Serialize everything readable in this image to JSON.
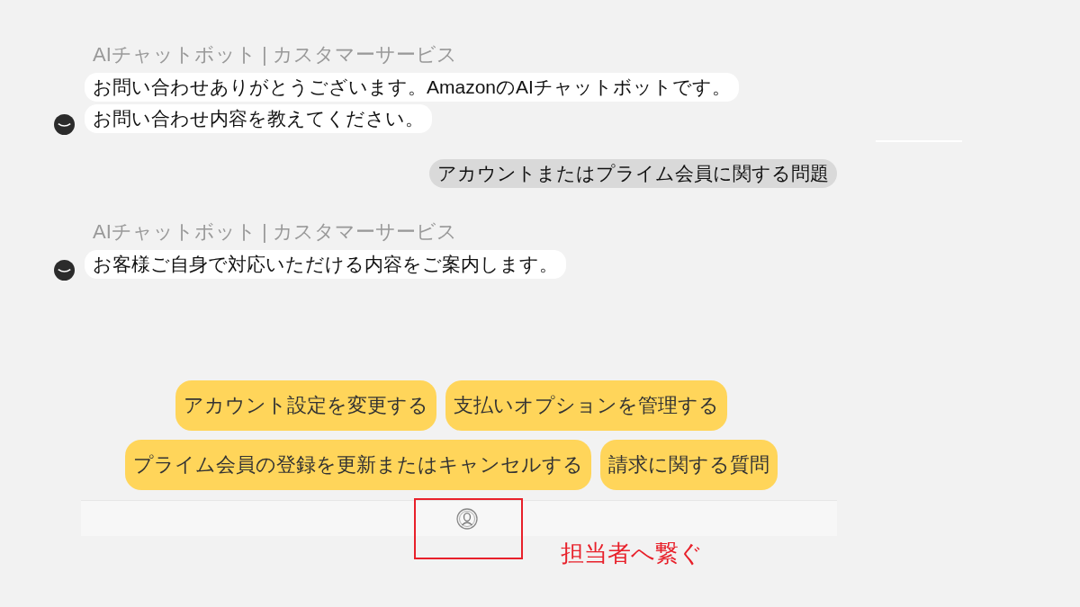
{
  "messages": [
    {
      "kind": "bot",
      "sender": "AIチャットボット | カスタマーサービス",
      "lines": [
        "お問い合わせありがとうございます。AmazonのAIチャットボットです。",
        "お問い合わせ内容を教えてください。"
      ]
    },
    {
      "kind": "user",
      "lines": [
        "アカウントまたはプライム会員に関する問題"
      ]
    },
    {
      "kind": "bot",
      "sender": "AIチャットボット | カスタマーサービス",
      "lines": [
        "お客様ご自身で対応いただける内容をご案内します。"
      ]
    }
  ],
  "quick_replies": [
    [
      "アカウント設定を変更する",
      "支払いオプションを管理する"
    ],
    [
      "プライム会員の登録を更新またはキャンセルする",
      "請求に関する質問"
    ]
  ],
  "annotation": {
    "label": "担当者へ繋ぐ"
  }
}
